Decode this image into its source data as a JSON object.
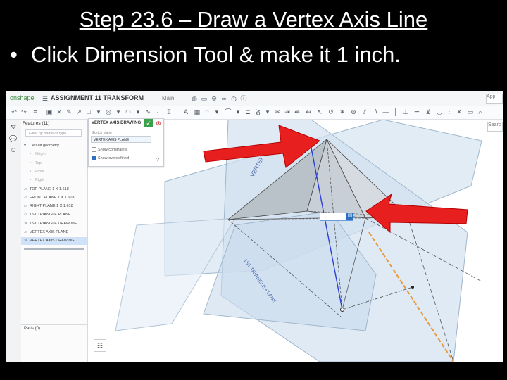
{
  "slide": {
    "title": "Step 23.6 – Draw a Vertex Axis Line",
    "bullet": "Click Dimension Tool & make it 1 inch."
  },
  "app": {
    "logo": "onshape",
    "doc_name": "ASSIGNMENT 11 TRANSFORM",
    "branch": "Main",
    "apps_label": "App",
    "search_label": "Searc"
  },
  "feature_panel": {
    "header": "Features (11)",
    "filter_placeholder": "Filter by name or type",
    "items": [
      {
        "label": "Default geometry",
        "kind": "group"
      },
      {
        "label": "Origin",
        "kind": "sub"
      },
      {
        "label": "Top",
        "kind": "sub"
      },
      {
        "label": "Front",
        "kind": "sub"
      },
      {
        "label": "Right",
        "kind": "sub"
      },
      {
        "label": "TOP PLANE 1 X 1.618",
        "kind": "plane"
      },
      {
        "label": "FRONT PLANE 1 X 1.618",
        "kind": "plane"
      },
      {
        "label": "RIGHT PLANE 1 X 1.618",
        "kind": "plane"
      },
      {
        "label": "1ST TRIANGLE PLANE",
        "kind": "plane"
      },
      {
        "label": "1ST TRIANGLE DRAWING",
        "kind": "sketch"
      },
      {
        "label": "VERTEX AXIS PLANE",
        "kind": "plane"
      },
      {
        "label": "VERTEX AXIS DRAWING",
        "kind": "sketch",
        "selected": true
      }
    ],
    "parts": "Parts (0)"
  },
  "sketch_dialog": {
    "title": "VERTEX AXIS DRAWING",
    "ok_icon": "check-icon",
    "cancel_icon": "close-icon",
    "plane_label": "Sketch plane",
    "plane_value": "VERTEX AXIS PLANE",
    "show_constraints": "Show constraints",
    "show_overdefined": "Show overdefined"
  },
  "viewport": {
    "plane_label_1": "VERTEX AXIS",
    "plane_label_2": "1ST TRIANGLE PLANE",
    "colors": {
      "annotation_arrow": "#e81f1f",
      "axis_line": "#2b3fd6",
      "orange_line": "#e8963a",
      "plane_fill": "#d9e6f2",
      "plane_edge": "#9fb6cc"
    }
  }
}
